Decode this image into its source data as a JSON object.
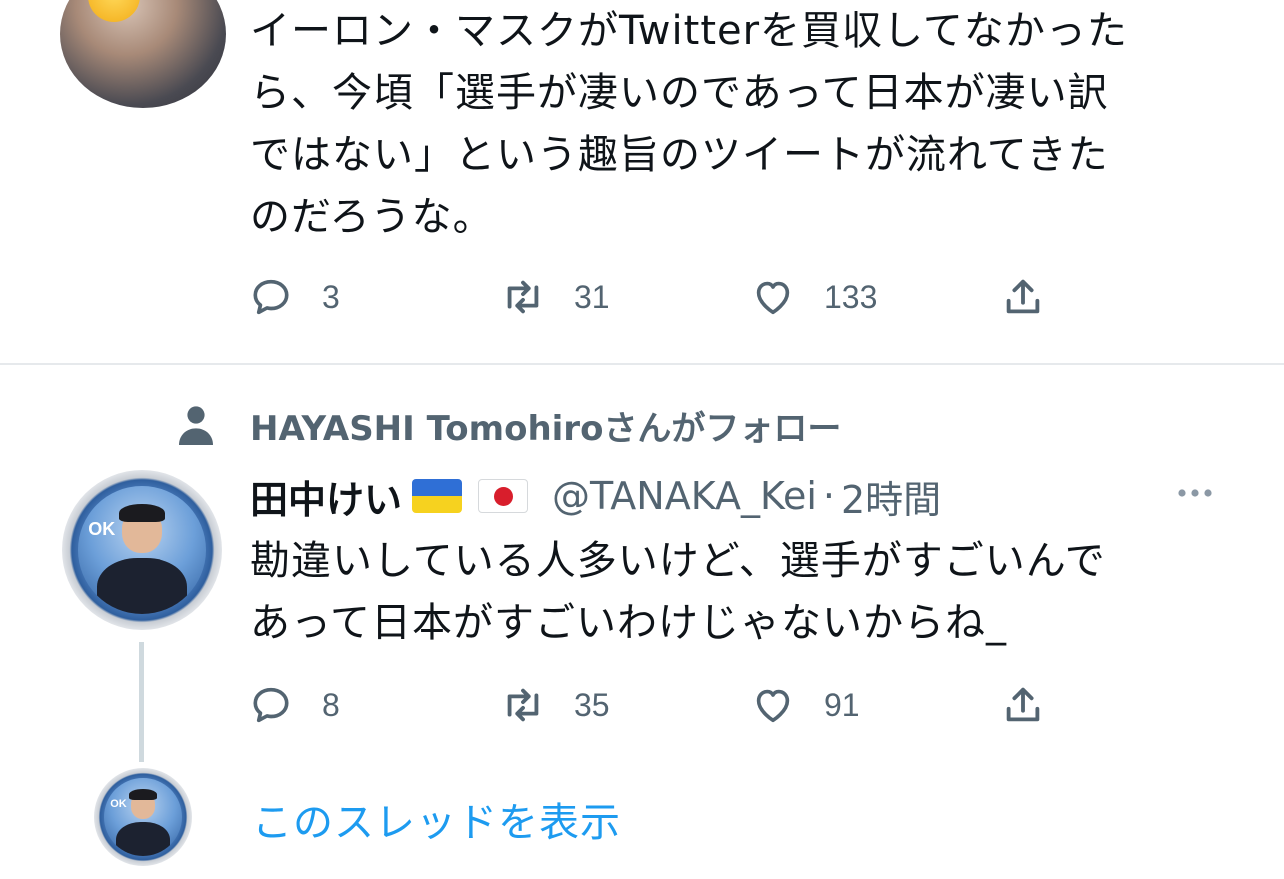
{
  "top_tweet": {
    "text_lines": [
      "イーロン・マスクがTwitterを買収してなかった",
      "ら、今頃「選手が凄いのであって日本が凄い訳",
      "ではない」という趣旨のツイートが流れてきた",
      "のだろうな。"
    ],
    "actions": {
      "reply_icon": "reply-bubble-icon",
      "reply_count": "3",
      "retweet_icon": "retweet-icon",
      "retweet_count": "31",
      "like_icon": "heart-icon",
      "like_count": "133",
      "share_icon": "share-icon"
    }
  },
  "social_context": {
    "icon": "person-icon",
    "label": "HAYASHI Tomohiroさんがフォロー"
  },
  "main_tweet": {
    "display_name": "田中けい",
    "flags": [
      "ukraine-flag-icon",
      "japan-flag-icon"
    ],
    "handle": "@TANAKA_Kei",
    "separator": "·",
    "time": "2時間",
    "more_icon": "more-dots-icon",
    "text_lines": [
      "勘違いしている人多いけど、選手がすごいんで",
      "あって日本がすごいわけじゃないからね_"
    ],
    "avatar_badge_text": "OK",
    "actions": {
      "reply_count": "8",
      "retweet_count": "35",
      "like_count": "91"
    }
  },
  "thread": {
    "avatar_badge_text": "OK",
    "show_thread_label": "このスレッドを表示"
  },
  "colors": {
    "text": "#0f1419",
    "secondary": "#536471",
    "link": "#1d9bf0",
    "divider": "#e6e9ec"
  }
}
